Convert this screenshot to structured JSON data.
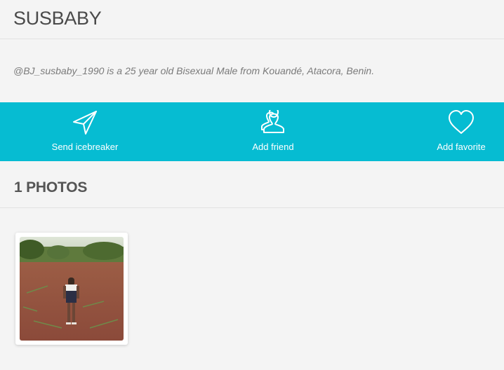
{
  "profile": {
    "username": "SUSBABY",
    "bio": "@BJ_susbaby_1990 is a 25 year old Bisexual Male from Kouandé, Atacora, Benin."
  },
  "actions": {
    "send_icebreaker": {
      "label": "Send icebreaker",
      "icon": "paper-plane-icon"
    },
    "add_friend": {
      "label": "Add friend",
      "icon": "people-icon"
    },
    "add_favorite": {
      "label": "Add favorite",
      "icon": "heart-icon"
    }
  },
  "photos": {
    "title": "1 PHOTOS"
  },
  "colors": {
    "accent": "#06bcd2",
    "background": "#f4f4f4"
  }
}
